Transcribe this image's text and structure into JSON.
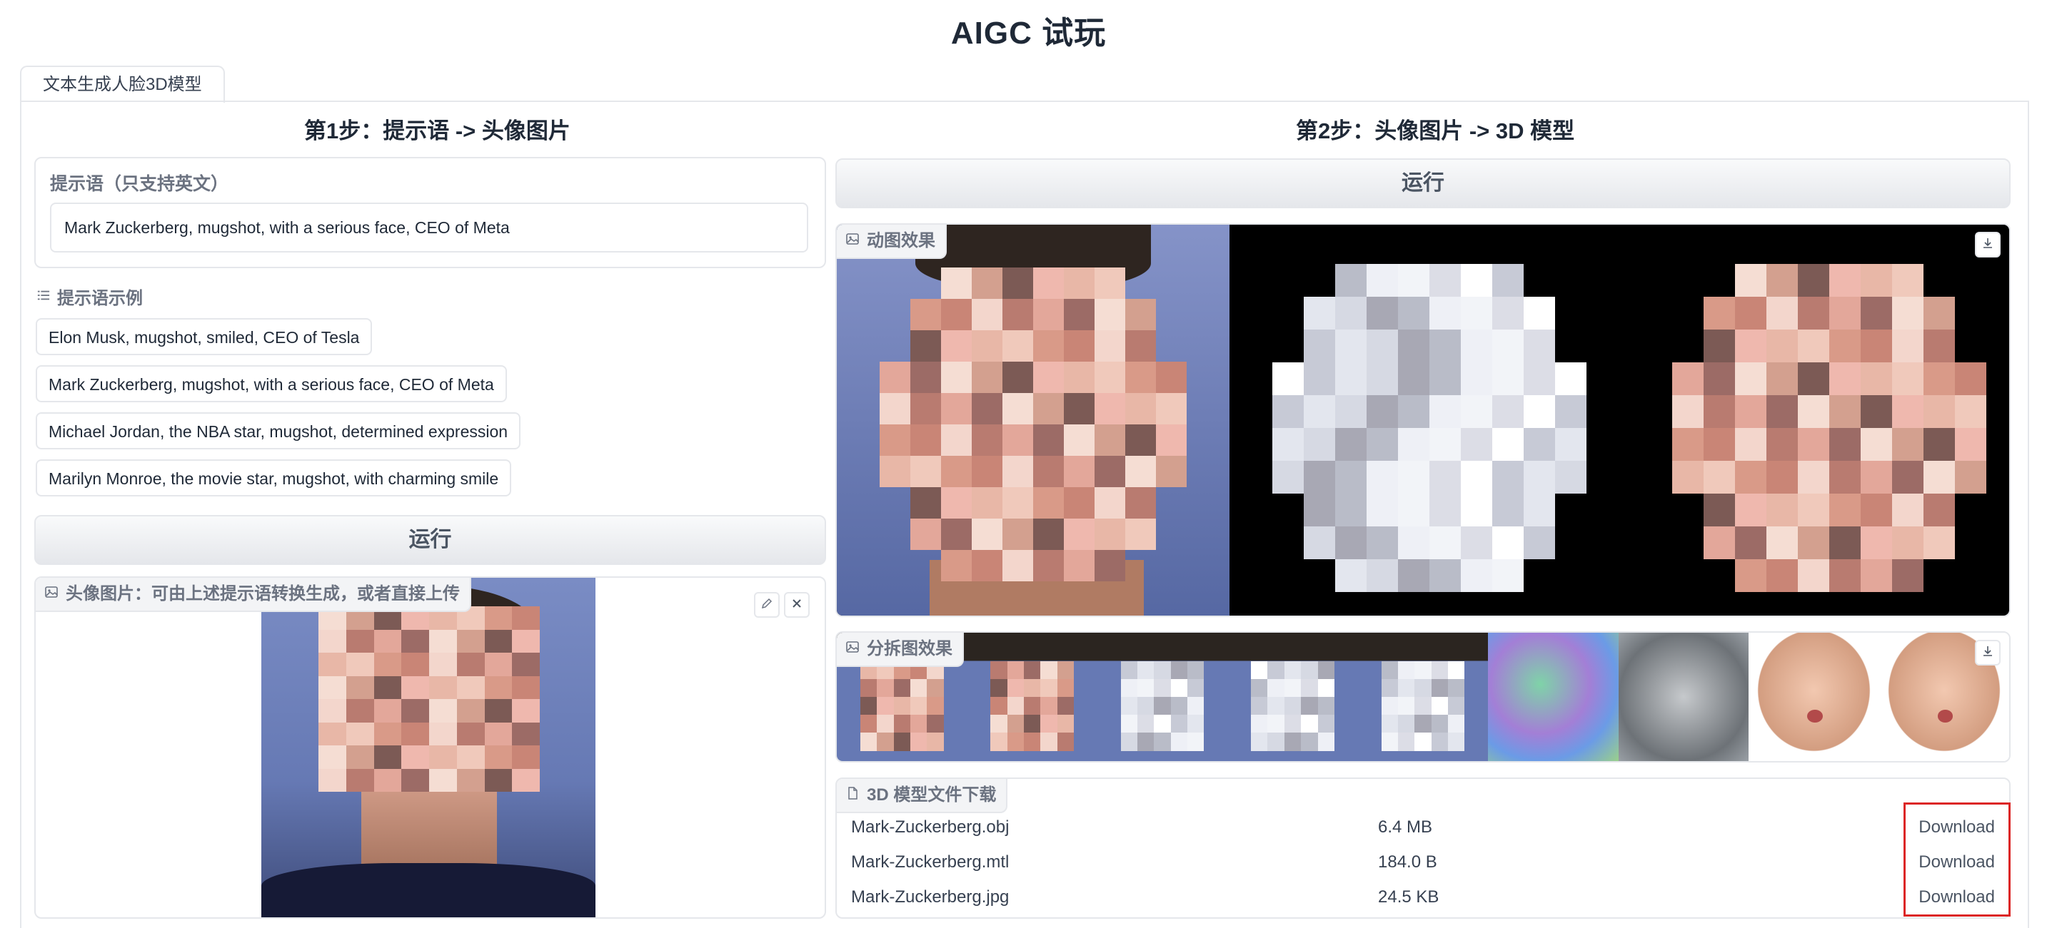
{
  "app_title": "AIGC 试玩",
  "tab": {
    "label": "文本生成人脸3D模型"
  },
  "step1": {
    "title": "第1步：提示语 -> 头像图片",
    "prompt_label": "提示语（只支持英文）",
    "prompt_value": "Mark Zuckerberg, mugshot, with a serious face, CEO of Meta",
    "examples_label": "提示语示例",
    "examples": [
      "Elon Musk, mugshot, smiled, CEO of Tesla",
      "Mark Zuckerberg, mugshot, with a serious face, CEO of Meta",
      "Michael Jordan, the NBA star, mugshot, determined expression",
      "Marilyn Monroe, the movie star, mugshot, with charming smile"
    ],
    "run_label": "运行",
    "image_label": "头像图片：可由上述提示语转换生成，或者直接上传"
  },
  "step2": {
    "title": "第2步：头像图片 -> 3D 模型",
    "run_label": "运行",
    "animation_label": "动图效果",
    "split_label": "分拆图效果",
    "files_label": "3D 模型文件下载",
    "files": [
      {
        "name": "Mark-Zuckerberg.obj",
        "size": "6.4 MB",
        "link": "Download"
      },
      {
        "name": "Mark-Zuckerberg.mtl",
        "size": "184.0 B",
        "link": "Download"
      },
      {
        "name": "Mark-Zuckerberg.jpg",
        "size": "24.5 KB",
        "link": "Download"
      }
    ]
  },
  "icons": {
    "image": "image-icon",
    "list": "list-icon",
    "edit": "pencil-icon",
    "close": "close-icon",
    "download": "download-icon",
    "file": "file-icon"
  },
  "colors": {
    "border": "#e5e7eb",
    "label_bg": "#f3f4f6",
    "highlight": "#dc2626",
    "portrait_bg": "#6b7db8"
  }
}
